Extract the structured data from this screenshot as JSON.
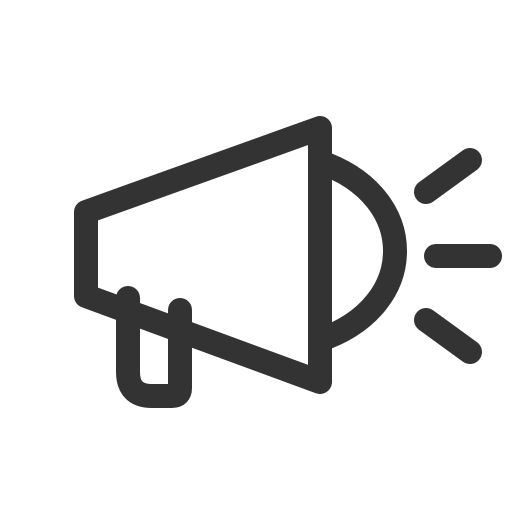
{
  "icon": {
    "name": "megaphone-icon",
    "stroke_color": "#333333",
    "background_color": "#ffffff"
  }
}
